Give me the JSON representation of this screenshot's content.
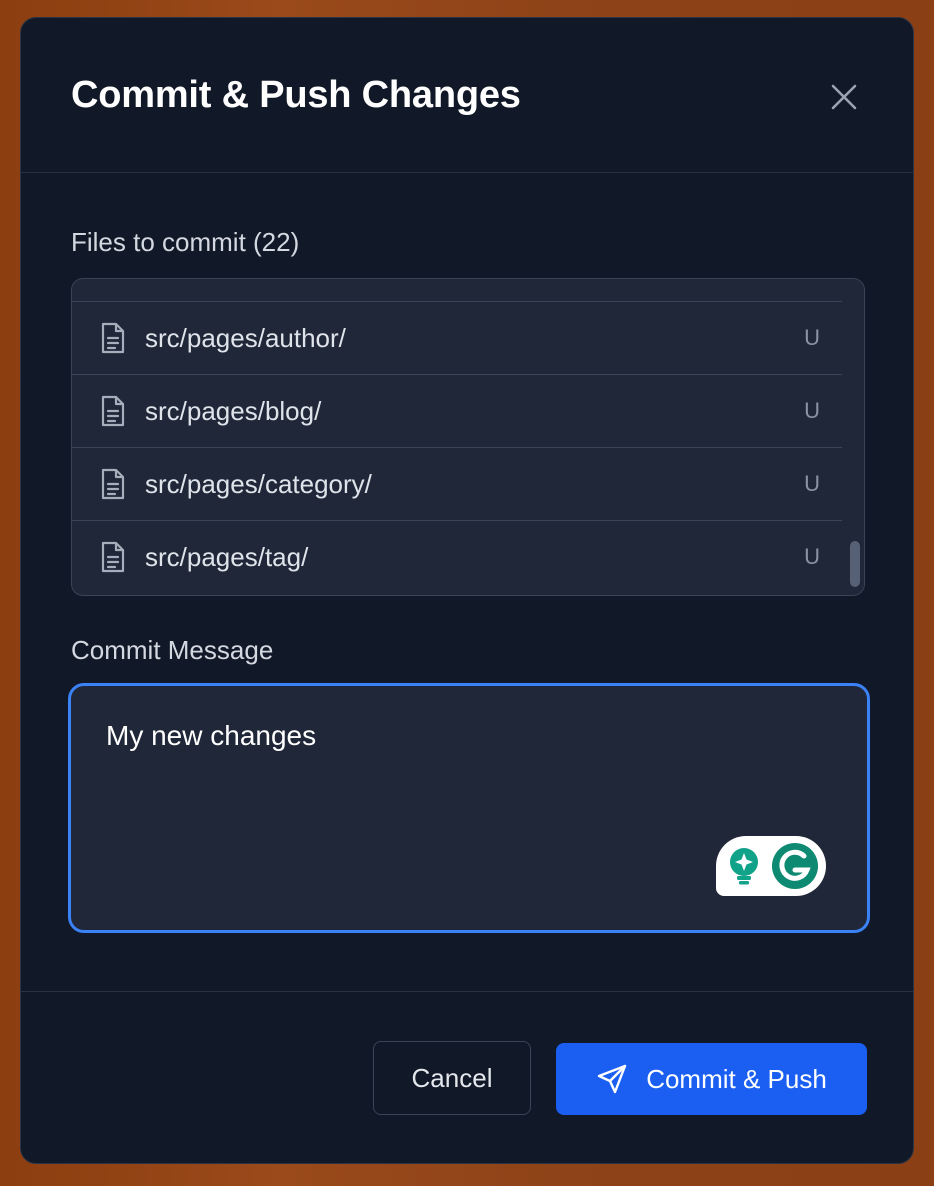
{
  "dialog": {
    "title": "Commit & Push Changes",
    "close_icon": "close-icon"
  },
  "files": {
    "label": "Files to commit (22)",
    "items": [
      {
        "name": "src/pages/author/",
        "status": "U"
      },
      {
        "name": "src/pages/blog/",
        "status": "U"
      },
      {
        "name": "src/pages/category/",
        "status": "U"
      },
      {
        "name": "src/pages/tag/",
        "status": "U"
      }
    ],
    "file_icon": "file-text-icon"
  },
  "message": {
    "label": "Commit Message",
    "value": "My new changes"
  },
  "grammarly": {
    "icons": [
      "lightbulb-sparkle-icon",
      "grammarly-logo-icon"
    ]
  },
  "footer": {
    "cancel_label": "Cancel",
    "commit_label": "Commit & Push",
    "commit_icon": "send-icon"
  },
  "colors": {
    "accent": "#1a5ff2",
    "focus_ring": "#3b82f6",
    "dialog_bg": "#111827",
    "panel_bg": "#1f2738"
  }
}
